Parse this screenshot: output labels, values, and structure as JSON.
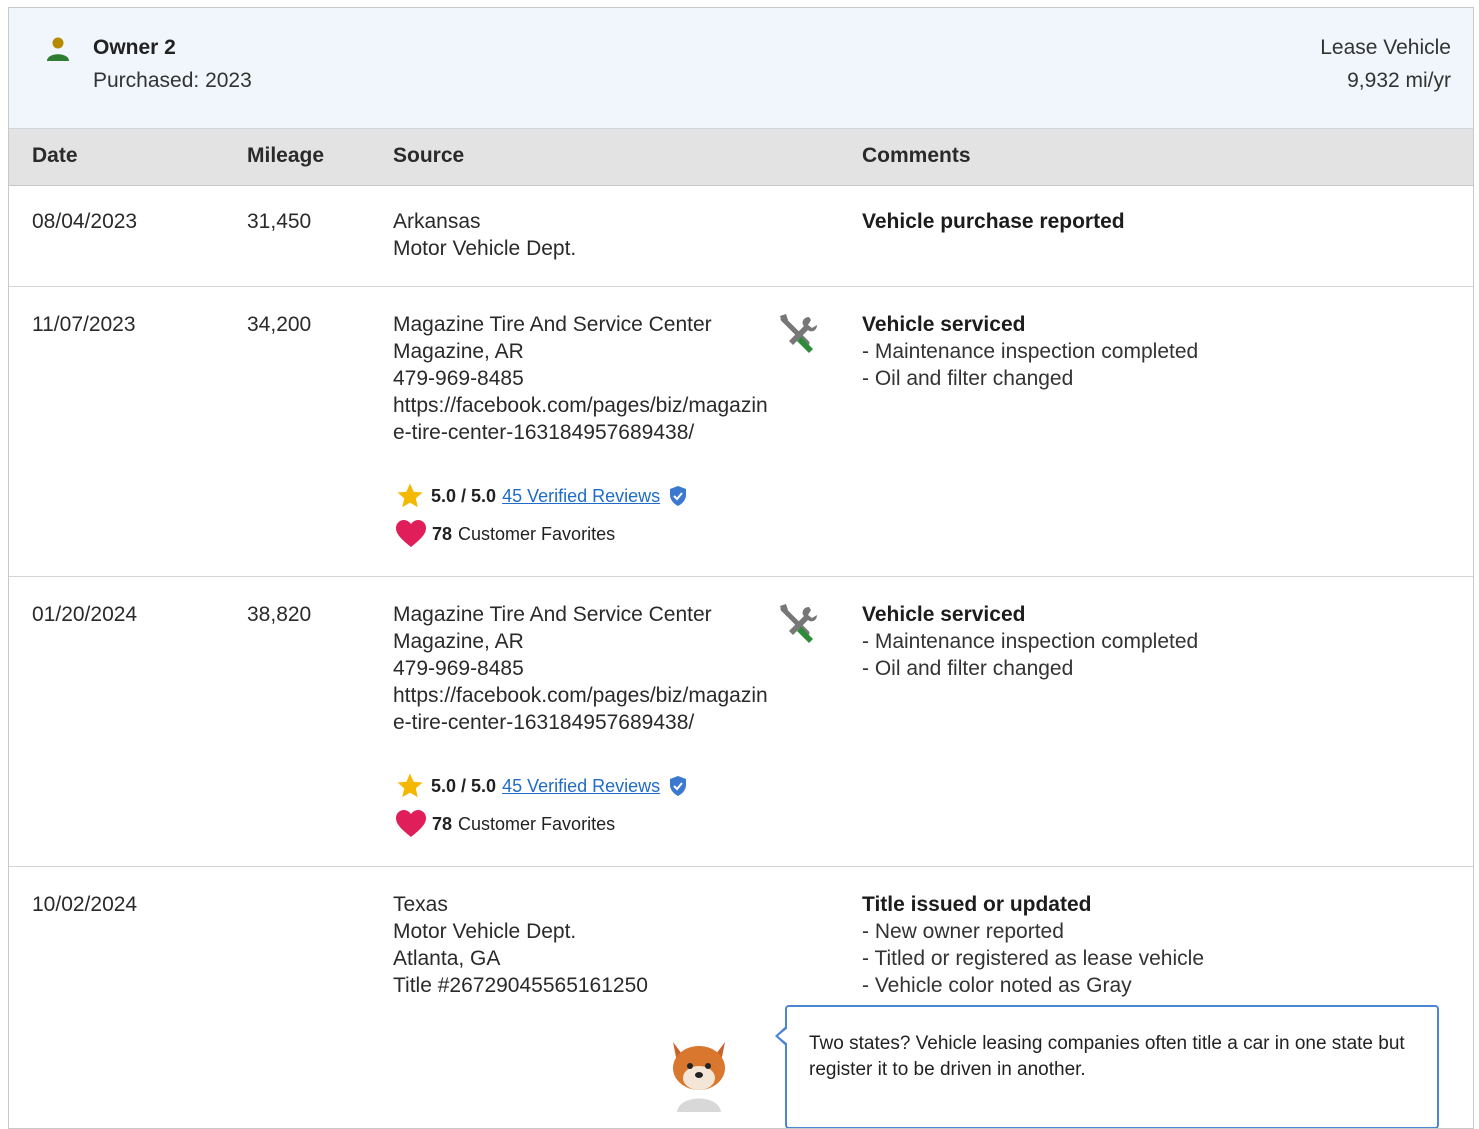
{
  "owner": {
    "name": "Owner 2",
    "purchased": "Purchased: 2023",
    "type": "Lease Vehicle",
    "miles_per_year": "9,932 mi/yr",
    "icon": "person-icon"
  },
  "table": {
    "headers": {
      "date": "Date",
      "mileage": "Mileage",
      "source": "Source",
      "comments": "Comments"
    },
    "rows": [
      {
        "date": "08/04/2023",
        "mileage": "31,450",
        "source": [
          "Arkansas",
          "Motor Vehicle Dept."
        ],
        "comment_head": "Vehicle purchase reported",
        "comment_lines": []
      },
      {
        "date": "11/07/2023",
        "mileage": "34,200",
        "source": [
          "Magazine Tire And Service Center",
          "Magazine, AR",
          "479-969-8485",
          "https://facebook.com/pages/biz/magazine-tire-center-163184957689438/"
        ],
        "icon": "service-tools-icon",
        "rating": "5.0 / 5.0",
        "reviews": "45 Verified Reviews",
        "favorites_count": "78",
        "favorites_label": "Customer Favorites",
        "comment_head": "Vehicle serviced",
        "comment_lines": [
          "- Maintenance inspection completed",
          "- Oil and filter changed"
        ]
      },
      {
        "date": "01/20/2024",
        "mileage": "38,820",
        "source": [
          "Magazine Tire And Service Center",
          "Magazine, AR",
          "479-969-8485",
          "https://facebook.com/pages/biz/magazine-tire-center-163184957689438/"
        ],
        "icon": "service-tools-icon",
        "rating": "5.0 / 5.0",
        "reviews": "45 Verified Reviews",
        "favorites_count": "78",
        "favorites_label": "Customer Favorites",
        "comment_head": "Vehicle serviced",
        "comment_lines": [
          "- Maintenance inspection completed",
          "- Oil and filter changed"
        ]
      },
      {
        "date": "10/02/2024",
        "mileage": "",
        "source": [
          "Texas",
          "Motor Vehicle Dept.",
          "Atlanta, GA",
          "Title #26729045565161250"
        ],
        "comment_head": "Title issued or updated",
        "comment_lines": [
          "- New owner reported",
          "- Titled or registered as lease vehicle",
          "- Vehicle color noted as Gray"
        ],
        "tip": "Two states? Vehicle leasing companies often title a car in one state but register it to be driven in another."
      }
    ]
  },
  "colors": {
    "accent_link": "#1f6cc9",
    "owner_icon": "#2e7d32",
    "heart": "#e01e5a",
    "star": "#f5b800",
    "tip_border": "#4a86d4"
  }
}
